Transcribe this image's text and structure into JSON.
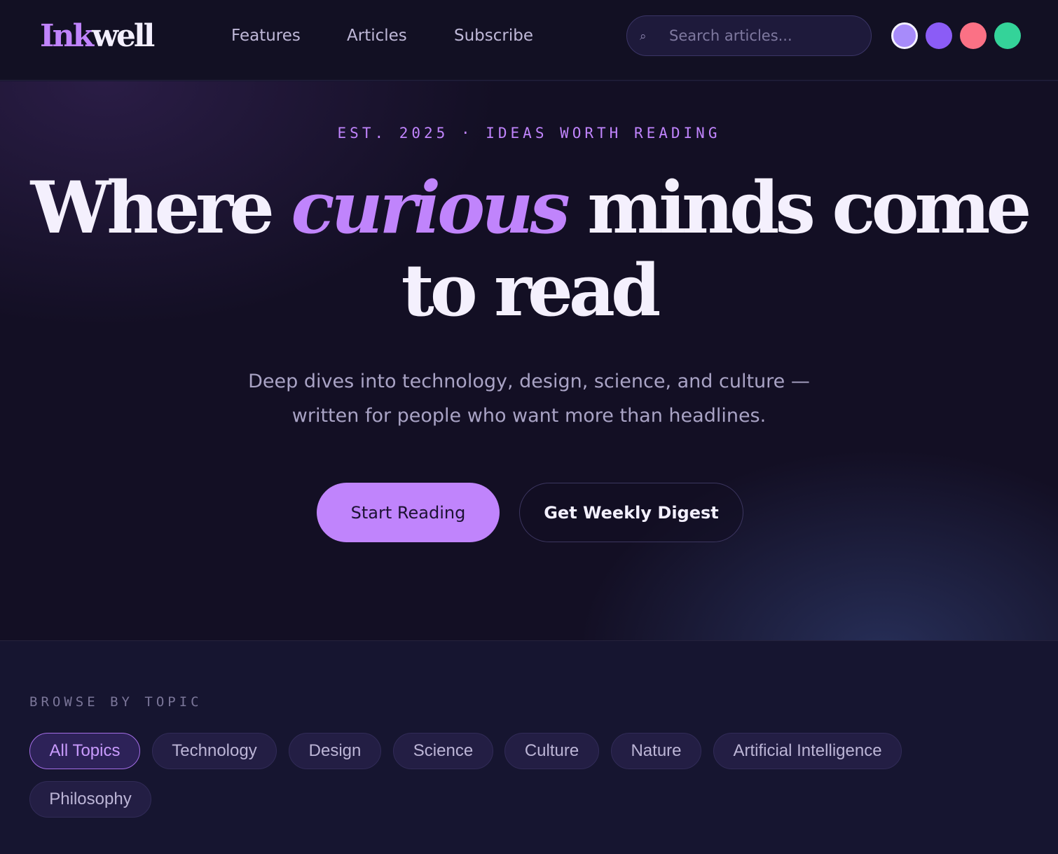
{
  "brand": {
    "part1": "Ink",
    "part2": "well"
  },
  "nav": {
    "links": [
      "Features",
      "Articles",
      "Subscribe"
    ],
    "search": {
      "placeholder": "Search articles...",
      "value": "",
      "icon": "search-icon"
    },
    "theme_swatches": [
      {
        "name": "lavender",
        "color": "#a78bfa",
        "active": true
      },
      {
        "name": "violet",
        "color": "#8b5cf6",
        "active": false
      },
      {
        "name": "coral",
        "color": "#fb7185",
        "active": false
      },
      {
        "name": "green",
        "color": "#34d399",
        "active": false
      }
    ]
  },
  "hero": {
    "eyebrow": "EST. 2025 · IDEAS WORTH READING",
    "headline": {
      "before": "Where ",
      "emphasis": "curious",
      "after": " minds come to read"
    },
    "subline": [
      "Deep dives into technology, design, science, and culture —",
      "written for people who want more than headlines."
    ],
    "primary_cta": "Start Reading",
    "secondary_cta": "Get Weekly Digest"
  },
  "topics": {
    "label": "BROWSE BY TOPIC",
    "items": [
      "All Topics",
      "Technology",
      "Design",
      "Science",
      "Culture",
      "Nature",
      "Artificial Intelligence",
      "Philosophy"
    ],
    "active": "All Topics"
  },
  "colors": {
    "accent": "#c084fc",
    "background": "#161530",
    "hero_background": "#130f24"
  }
}
